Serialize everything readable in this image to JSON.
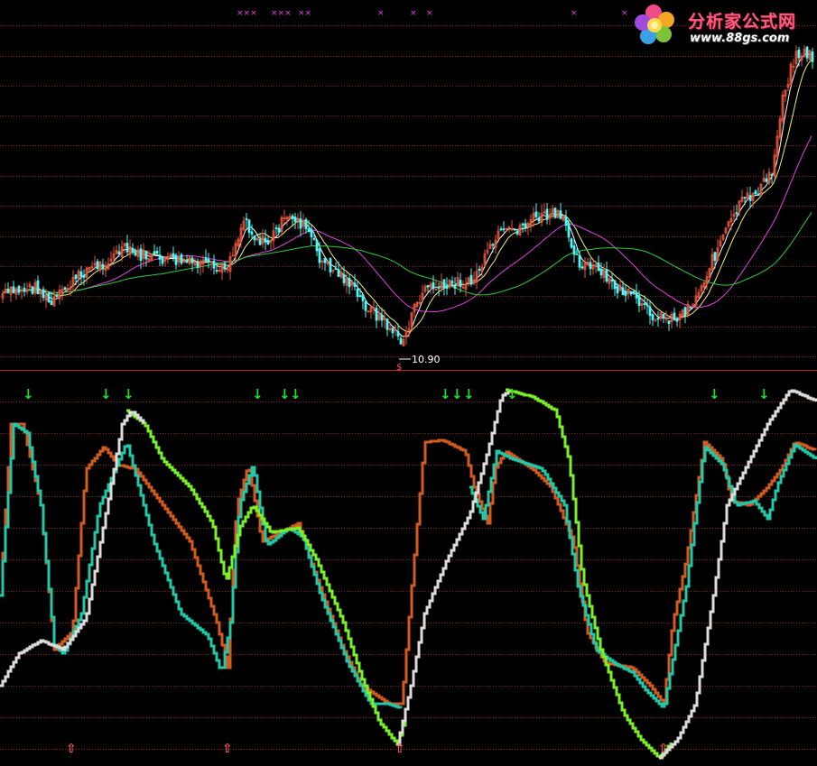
{
  "logo": {
    "brand_text": "分析家公式网",
    "url_text": "www.88gs.com"
  },
  "colors": {
    "background": "#000000",
    "grid": "#8b1a1a",
    "divider": "#c81e1e",
    "up_candle": "#e8553c",
    "down_candle": "#54f5f5",
    "ma_short": "#ffffff",
    "ma_mid": "#f0f07a",
    "ma_long": "#e043e0",
    "ma_longest": "#2ecc40",
    "orange_line": "#d45a1e",
    "teal_line": "#22c8a8",
    "green_line": "#7af02a",
    "white_line": "#dcdcdc",
    "sell_arrow": "#22dd22",
    "buy_arrow": "#ff5555",
    "cross_mark": "#e040e0"
  },
  "chart_data": [
    {
      "type": "candlestick",
      "title": "",
      "low_marker_label": "10.90",
      "candles_summary": "price trend: rises to local high near bar 90, falls to low 10.90 near bar 148, rebounds to peak near bar 205, dips near bar 245, then rallies sharply to new highs at the right edge",
      "moving_averages": [
        "ma_short",
        "ma_mid",
        "ma_long",
        "ma_longest"
      ],
      "top_cross_markers": [
        "×××",
        "×××",
        "××",
        "×",
        "×",
        "×",
        "×",
        "×"
      ]
    },
    {
      "type": "line",
      "title": "",
      "series": [
        {
          "color_key": "orange_line"
        },
        {
          "color_key": "teal_line"
        },
        {
          "color_key": "green_line"
        },
        {
          "color_key": "white_line"
        }
      ],
      "sell_arrows": 13,
      "buy_arrows": 4,
      "sell_arrow_glyph": "↓",
      "buy_arrow_glyph": "⇧"
    }
  ]
}
